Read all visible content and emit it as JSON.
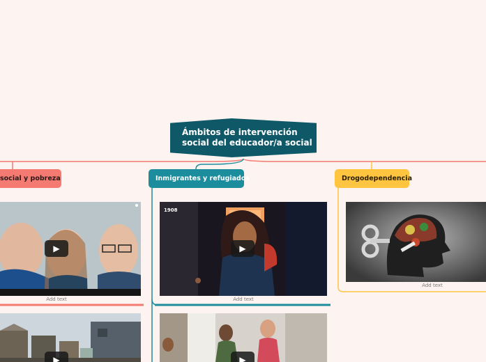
{
  "root": {
    "title_line1": "Ámbitos de intervención",
    "title_line2": "social del educador/a social"
  },
  "branches": [
    {
      "label": "social y pobreza",
      "color": "#f47a72"
    },
    {
      "label": "Inmigrantes y refugiados",
      "color": "#1b8d9c"
    },
    {
      "label": "Drogodependencia",
      "color": "#ffc540"
    }
  ],
  "items": {
    "left_video": {
      "caption": "Add text",
      "play_icon": "play-icon"
    },
    "mid_video": {
      "caption": "Add text",
      "badge": "1908",
      "play_icon": "play-icon"
    },
    "right_image": {
      "caption": "Add text"
    }
  },
  "colors": {
    "background": "#fdf3f0",
    "root": "#0e5868"
  }
}
